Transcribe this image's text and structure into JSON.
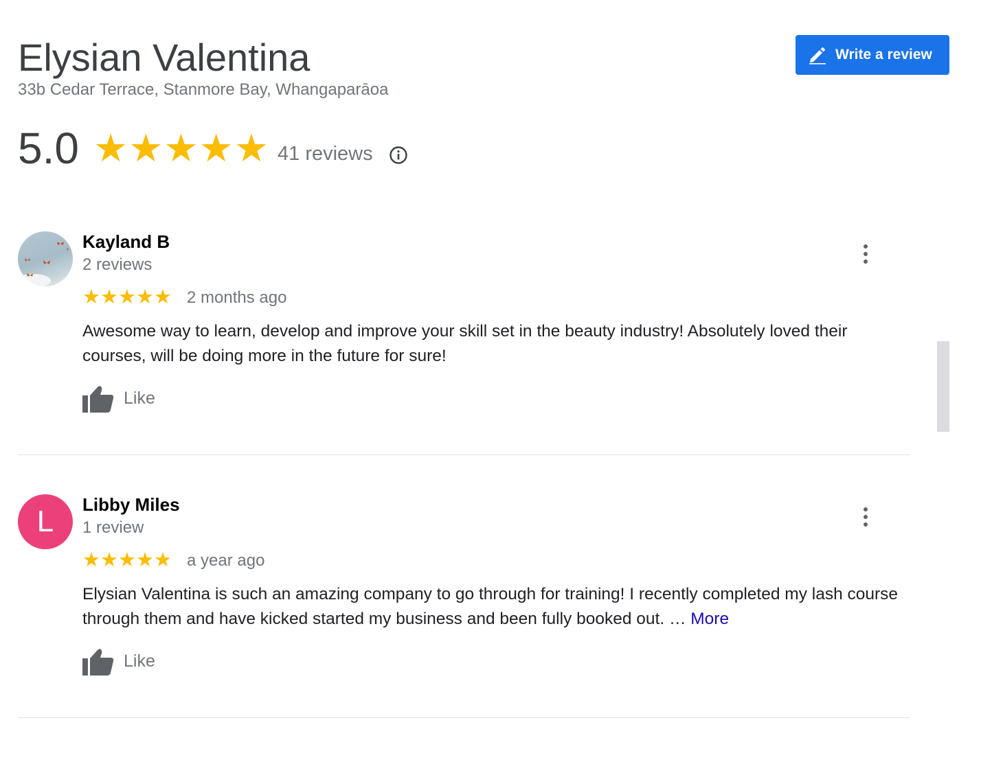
{
  "place": {
    "name": "Elysian Valentina",
    "address": "33b Cedar Terrace, Stanmore Bay, Whangaparāoa"
  },
  "write_review": {
    "label": "Write a review",
    "icon": "pencil-icon"
  },
  "summary": {
    "score": "5.0",
    "stars": 5,
    "total_reviews": "41 reviews",
    "info_icon": "info-icon"
  },
  "colors": {
    "accent": "#1a73e8",
    "star": "#fbbc04",
    "link": "#1a0dab",
    "avatar_letter_bg": "#ec407a"
  },
  "reviews": [
    {
      "name": "Kayland B",
      "review_count": "2 reviews",
      "avatar": "photo",
      "rating": 5,
      "time": "2 months ago",
      "text": "Awesome way to learn, develop and improve your skill set in the beauty industry! Absolutely loved their courses, will be doing more in the future for sure!",
      "like_label": "Like"
    },
    {
      "name": "Libby Miles",
      "review_count": "1 review",
      "avatar": "L",
      "rating": 5,
      "time": "a year ago",
      "text": "Elysian Valentina is such an amazing company to go through for training! I recently completed my lash course through them and have kicked started my business and been fully booked out. …",
      "more_label": "More",
      "like_label": "Like"
    }
  ]
}
